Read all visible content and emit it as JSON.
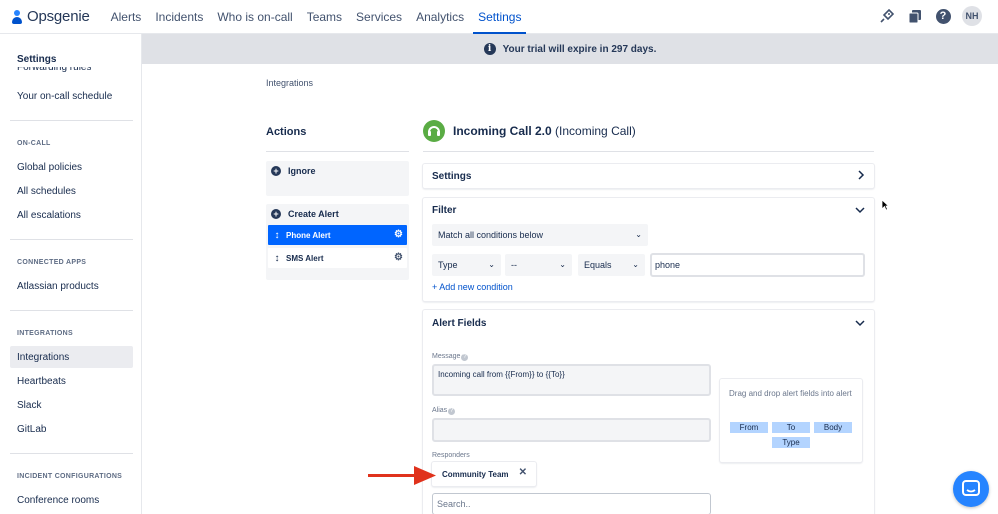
{
  "nav": {
    "logo": "Opsgenie",
    "items": [
      {
        "label": "Alerts"
      },
      {
        "label": "Incidents"
      },
      {
        "label": "Who is on-call"
      },
      {
        "label": "Teams"
      },
      {
        "label": "Services"
      },
      {
        "label": "Analytics"
      },
      {
        "label": "Settings",
        "active": true
      }
    ],
    "avatar": "NH",
    "help": "?"
  },
  "sidebar": {
    "title": "Settings",
    "cut_item": "Forwarding rules",
    "top_items": [
      {
        "label": "Your on-call schedule"
      }
    ],
    "sections": [
      {
        "title": "ON-CALL",
        "items": [
          {
            "label": "Global policies"
          },
          {
            "label": "All schedules"
          },
          {
            "label": "All escalations"
          }
        ]
      },
      {
        "title": "CONNECTED APPS",
        "items": [
          {
            "label": "Atlassian products"
          }
        ]
      },
      {
        "title": "INTEGRATIONS",
        "items": [
          {
            "label": "Integrations",
            "active": true
          },
          {
            "label": "Heartbeats"
          },
          {
            "label": "Slack"
          },
          {
            "label": "GitLab"
          }
        ]
      },
      {
        "title": "INCIDENT CONFIGURATIONS",
        "items": [
          {
            "label": "Conference rooms"
          }
        ]
      }
    ]
  },
  "banner": {
    "icon": "info-icon",
    "text": "Your trial will expire in 297 days."
  },
  "breadcrumb": "Integrations",
  "actions": {
    "title": "Actions",
    "ignore_label": "Ignore",
    "create_alert_label": "Create Alert",
    "rules": [
      {
        "label": "Phone Alert",
        "active": true
      },
      {
        "label": "SMS Alert",
        "active": false
      }
    ]
  },
  "integration": {
    "name": "Incoming Call 2.0",
    "type": "(Incoming Call)",
    "brand_color": "#5aac44"
  },
  "settings_panel": {
    "title": "Settings"
  },
  "filter": {
    "title": "Filter",
    "match": "Match all conditions below",
    "condition": {
      "field": "Type",
      "not": "--",
      "operator": "Equals",
      "value": "phone"
    },
    "add_label": "+ Add new condition"
  },
  "alert_fields": {
    "title": "Alert Fields",
    "message_label": "Message",
    "message_value": "Incoming call from {{From}} to {{To}}",
    "alias_label": "Alias",
    "alias_value": "",
    "drag_hint": "Drag and drop alert fields into alert",
    "chips": [
      "From",
      "To",
      "Body",
      "Type"
    ],
    "responders_label": "Responders",
    "responder": "Community Team",
    "search_placeholder": "Search.."
  },
  "colors": {
    "accent": "#0052cc",
    "active_rule": "#0065ff",
    "arrow": "#e0321c",
    "chat": "#2684ff"
  }
}
